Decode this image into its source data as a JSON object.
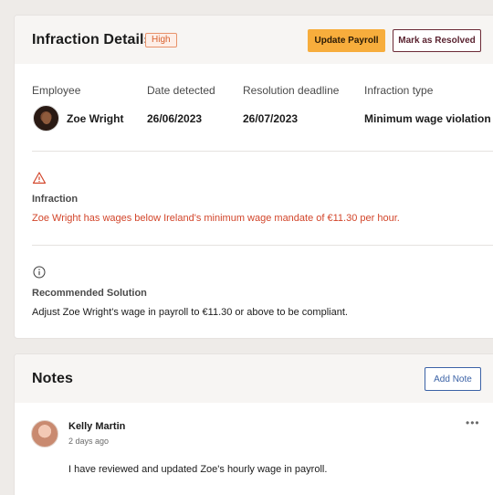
{
  "infraction": {
    "title": "Infraction Details",
    "severity": "High",
    "update_payroll_label": "Update Payroll",
    "mark_resolved_label": "Mark as Resolved",
    "columns": {
      "employee_label": "Employee",
      "date_detected_label": "Date detected",
      "resolution_deadline_label": "Resolution deadline",
      "infraction_type_label": "Infraction type"
    },
    "values": {
      "employee_name": "Zoe Wright",
      "date_detected": "26/06/2023",
      "resolution_deadline": "26/07/2023",
      "infraction_type": "Minimum wage violation"
    },
    "infraction_section": {
      "label": "Infraction",
      "text": "Zoe Wright has wages below Ireland's minimum wage mandate of €11.30 per hour."
    },
    "solution_section": {
      "label": "Recommended Solution",
      "text": "Adjust Zoe Wright's wage in payroll to €11.30 or above to be compliant."
    }
  },
  "notes": {
    "title": "Notes",
    "add_note_label": "Add Note",
    "items": [
      {
        "author": "Kelly Martin",
        "time": "2 days ago",
        "text": "I have reviewed and updated Zoe's hourly wage in payroll."
      }
    ]
  },
  "colors": {
    "accent_orange": "#f7ad3c",
    "danger_red": "#d2452a",
    "severity_badge": "#d8612f",
    "link_blue": "#3b62a6",
    "resolve_border": "#6b2a36"
  }
}
